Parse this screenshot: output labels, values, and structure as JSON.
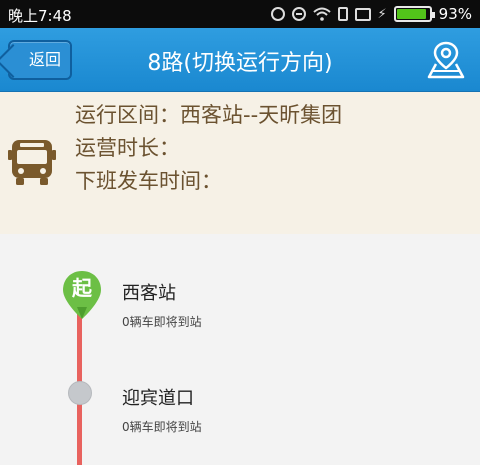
{
  "status_bar": {
    "time": "晚上7:48",
    "battery_percent": "93%",
    "battery_level": 0.93,
    "icons": [
      "alarm-icon",
      "dnd-icon",
      "wifi-icon",
      "vibrate-icon",
      "sim-icon",
      "charge-icon",
      "battery-icon"
    ]
  },
  "header": {
    "back_label": "返回",
    "title": "8路(切换运行方向)",
    "map_icon": "map-pin-icon"
  },
  "info": {
    "route_range": "运行区间：西客站--天昕集团",
    "operating_hours": "运营时长：",
    "last_departure": "下班发车时间："
  },
  "stops": [
    {
      "marker": "起",
      "name": "西客站",
      "status": "0辆车即将到站"
    },
    {
      "name": "迎宾道口",
      "status": "0辆车即将到站"
    }
  ],
  "colors": {
    "header_blue": "#1a88d0",
    "info_bg": "#f6f1e6",
    "info_text": "#6b5230",
    "route_line": "#e8625e",
    "start_marker": "#6cbf45",
    "stop_dot": "#c5c8cc"
  }
}
